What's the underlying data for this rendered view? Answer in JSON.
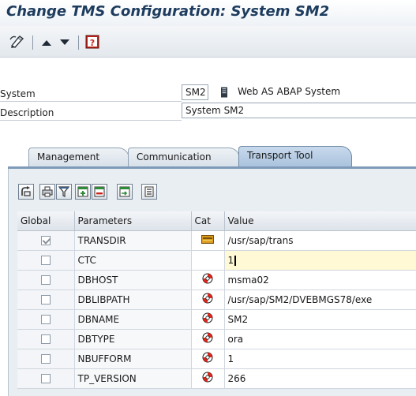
{
  "window": {
    "title": "Change TMS Configuration: System SM2"
  },
  "toolbar": {
    "buttons": [
      {
        "icon": "display-change-icon"
      },
      {
        "icon": "arrow-up-icon"
      },
      {
        "icon": "arrow-down-icon"
      },
      {
        "icon": "help-icon"
      }
    ]
  },
  "header": {
    "system_label": "System",
    "system_value": "SM2",
    "system_type_icon": "server-icon",
    "system_type": "Web AS ABAP System",
    "description_label": "Description",
    "description_value": "System SM2"
  },
  "tabs": [
    {
      "label": "Management",
      "active": false
    },
    {
      "label": "Communication",
      "active": false
    },
    {
      "label": "Transport Tool",
      "active": true
    }
  ],
  "table_toolbar": {
    "buttons": [
      "detail-icon",
      "print-icon",
      "filter-icon",
      "insert-row-icon",
      "delete-row-icon",
      "append-row-icon",
      "settings-icon"
    ]
  },
  "table": {
    "columns": [
      "Global",
      "Parameters",
      "Cat",
      "Value"
    ],
    "rows": [
      {
        "global": true,
        "param": "TRANSDIR",
        "cat": "folder-icon",
        "value": "/usr/sap/trans"
      },
      {
        "global": false,
        "param": "CTC",
        "cat": "",
        "value": "1"
      },
      {
        "global": false,
        "param": "DBHOST",
        "cat": "lifebuoy-icon",
        "value": "msma02"
      },
      {
        "global": false,
        "param": "DBLIBPATH",
        "cat": "lifebuoy-icon",
        "value": "/usr/sap/SM2/DVEBMGS78/exe"
      },
      {
        "global": false,
        "param": "DBNAME",
        "cat": "lifebuoy-icon",
        "value": "SM2"
      },
      {
        "global": false,
        "param": "DBTYPE",
        "cat": "lifebuoy-icon",
        "value": "ora"
      },
      {
        "global": false,
        "param": "NBUFFORM",
        "cat": "lifebuoy-icon",
        "value": "1"
      },
      {
        "global": false,
        "param": "TP_VERSION",
        "cat": "lifebuoy-icon",
        "value": "266"
      }
    ]
  },
  "colors": {
    "title": "#1d3c5e",
    "active_tab": "#a9c2dd",
    "editing_cell": "#fff9d6",
    "cat_red": "#e0251b"
  }
}
